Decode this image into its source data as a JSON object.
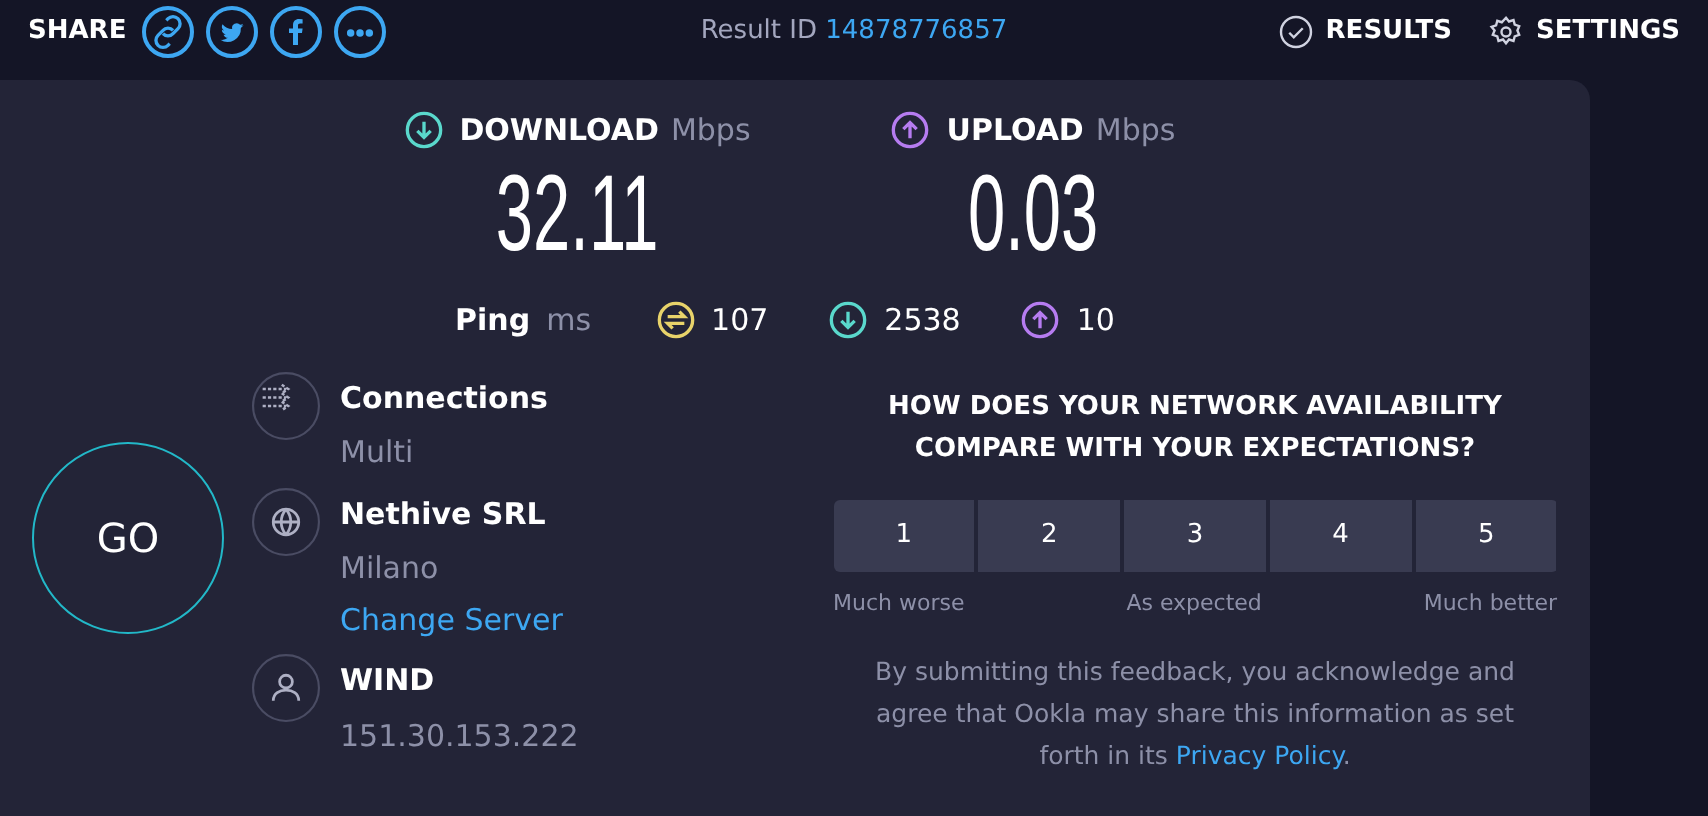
{
  "share": {
    "label": "SHARE",
    "icons": [
      {
        "kind": "link"
      },
      {
        "kind": "twitter"
      },
      {
        "kind": "facebook"
      },
      {
        "kind": "more"
      }
    ]
  },
  "result": {
    "label": "Result ID",
    "id": "14878776857"
  },
  "nav": [
    {
      "kind": "results",
      "label": "RESULTS"
    },
    {
      "kind": "settings",
      "label": "SETTINGS"
    }
  ],
  "speeds": [
    {
      "kind": "download",
      "label": "DOWNLOAD",
      "unit": "Mbps",
      "value": "32.11"
    },
    {
      "kind": "upload",
      "label": "UPLOAD",
      "unit": "Mbps",
      "value": "0.03"
    }
  ],
  "ping": {
    "label": "Ping",
    "unit": "ms",
    "readings": [
      {
        "kind": "idle",
        "value": "107"
      },
      {
        "kind": "download",
        "value": "2538"
      },
      {
        "kind": "upload",
        "value": "10"
      }
    ]
  },
  "go_button": "GO",
  "info": [
    {
      "kind": "connections",
      "title": "Connections",
      "subtitle": "Multi"
    },
    {
      "kind": "server",
      "title": "Nethive SRL",
      "subtitle": "Milano",
      "link": "Change Server"
    },
    {
      "kind": "provider",
      "title": "WIND",
      "subtitle": "151.30.153.222"
    }
  ],
  "feedback": {
    "question": "HOW DOES YOUR NETWORK AVAILABILITY COMPARE WITH YOUR EXPECTATIONS?",
    "ratings": [
      "1",
      "2",
      "3",
      "4",
      "5"
    ],
    "scale_labels": [
      "Much worse",
      "As expected",
      "Much better"
    ],
    "disclaimer": {
      "text": "By submitting this feedback, you acknowledge and agree that Ookla may share this information as set forth in its ",
      "link": "Privacy Policy",
      "end": "."
    }
  }
}
